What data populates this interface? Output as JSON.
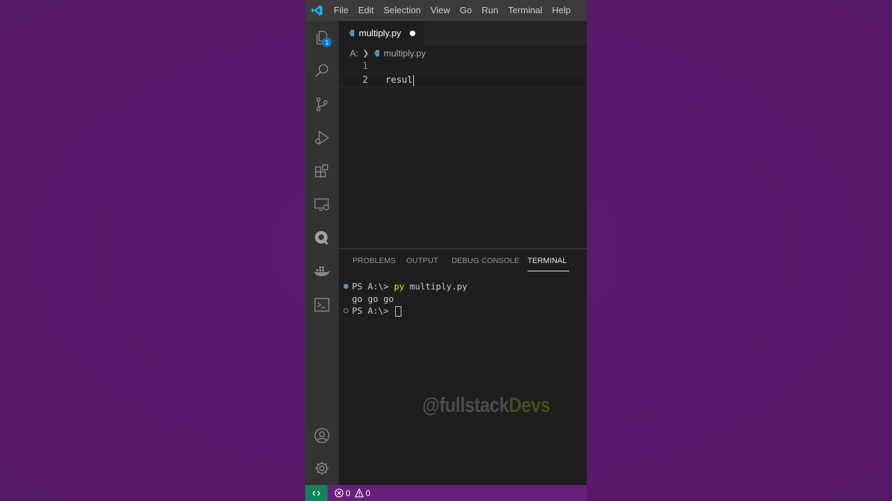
{
  "menu": [
    "File",
    "Edit",
    "Selection",
    "View",
    "Go",
    "Run",
    "Terminal",
    "Help"
  ],
  "activity_bar": {
    "explorer_badge": "1",
    "icons": [
      "explorer-icon",
      "search-icon",
      "source-control-icon",
      "run-debug-icon",
      "extensions-icon",
      "remote-explorer-icon",
      "quokka-icon",
      "docker-icon",
      "terminal-icon",
      "account-icon",
      "settings-gear-icon"
    ]
  },
  "editor": {
    "tab_label": "multiply.py",
    "breadcrumb": {
      "drive": "A:",
      "file": "multiply.py"
    },
    "lines": [
      {
        "number": "1",
        "text": ""
      },
      {
        "number": "2",
        "text": "resul"
      }
    ]
  },
  "panel": {
    "tabs": [
      "PROBLEMS",
      "OUTPUT",
      "DEBUG CONSOLE",
      "TERMINAL"
    ],
    "active_tab": "TERMINAL",
    "terminal": {
      "line1_prompt": "PS A:\\> ",
      "line1_cmd": "py",
      "line1_args": " multiply.py",
      "line2": "go go go",
      "line3_prompt": "PS A:\\> "
    }
  },
  "watermark": {
    "part1": "@fullstack",
    "part2": "Devs"
  },
  "status_bar": {
    "errors": "0",
    "warnings": "0"
  },
  "colors": {
    "accent": "#007acc",
    "status_bar": "#68217a",
    "remote": "#16825d",
    "python": "#519aba"
  }
}
